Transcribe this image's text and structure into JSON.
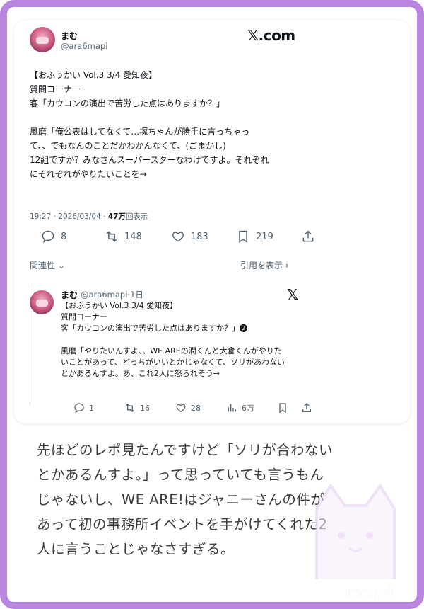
{
  "source_label": "𝕏.com",
  "tweet": {
    "author_name": "まむ",
    "author_handle": "@ara6mapi",
    "text_lines": [
      "【おふうかい Vol.3 3/4 愛知夜】",
      "質問コーナー",
      "客「カウコンの演出で苦労した点はありますか？」",
      "",
      "風磨「俺公表はしてなくて…塚ちゃんが勝手に言っちゃっ",
      "て、、でもなんのことだかわかんなくて、(ごまかし)",
      "12組ですか？みなさんスーパースターなわけですよ。それぞれ",
      "にそれぞれがやりたいことを→"
    ],
    "timestamp": "19:27 · 2026/03/04 · ",
    "views_count": "47万",
    "views_label": "回表示",
    "actions": {
      "replies": "8",
      "reposts": "148",
      "likes": "183",
      "bookmarks": "219"
    },
    "relevance_label": "関連性",
    "view_quotes_label": "引用を表示"
  },
  "quoted_tweet": {
    "author_name": "まむ",
    "author_handle_time": "@ara6mapi·1日",
    "text_lines": [
      "【おふうかい Vol.3 3/4 愛知夜】",
      "質問コーナー",
      "客「カウコンの演出で苦労した点はありますか？」",
      "",
      "風磨「やりたいんすよ、、WE AREの潤くんと大倉くんがやりた",
      "いことがあって、どっちがいいとかじゃなくて、ソリがあわない",
      "とかあるんすよ。あ、これ2人に怒られそう→"
    ],
    "thread_badge": "2",
    "actions": {
      "replies": "1",
      "reposts": "16",
      "likes": "28",
      "views": "6万"
    }
  },
  "caption_lines": [
    "先ほどのレポ見たんですけど「ソリが合わない",
    "とかあるんすよ。」って思っていても言うもん",
    "じゃないし、WE ARE!はジャニーさんの件が",
    "あって初の事務所イベントを手がけてくれた2",
    "人に言うことじゃなさすぎる。"
  ],
  "brand_mark": "mond",
  "colors": {
    "frame": "#b886df",
    "text": "#0f1419",
    "secondary": "#536471"
  }
}
